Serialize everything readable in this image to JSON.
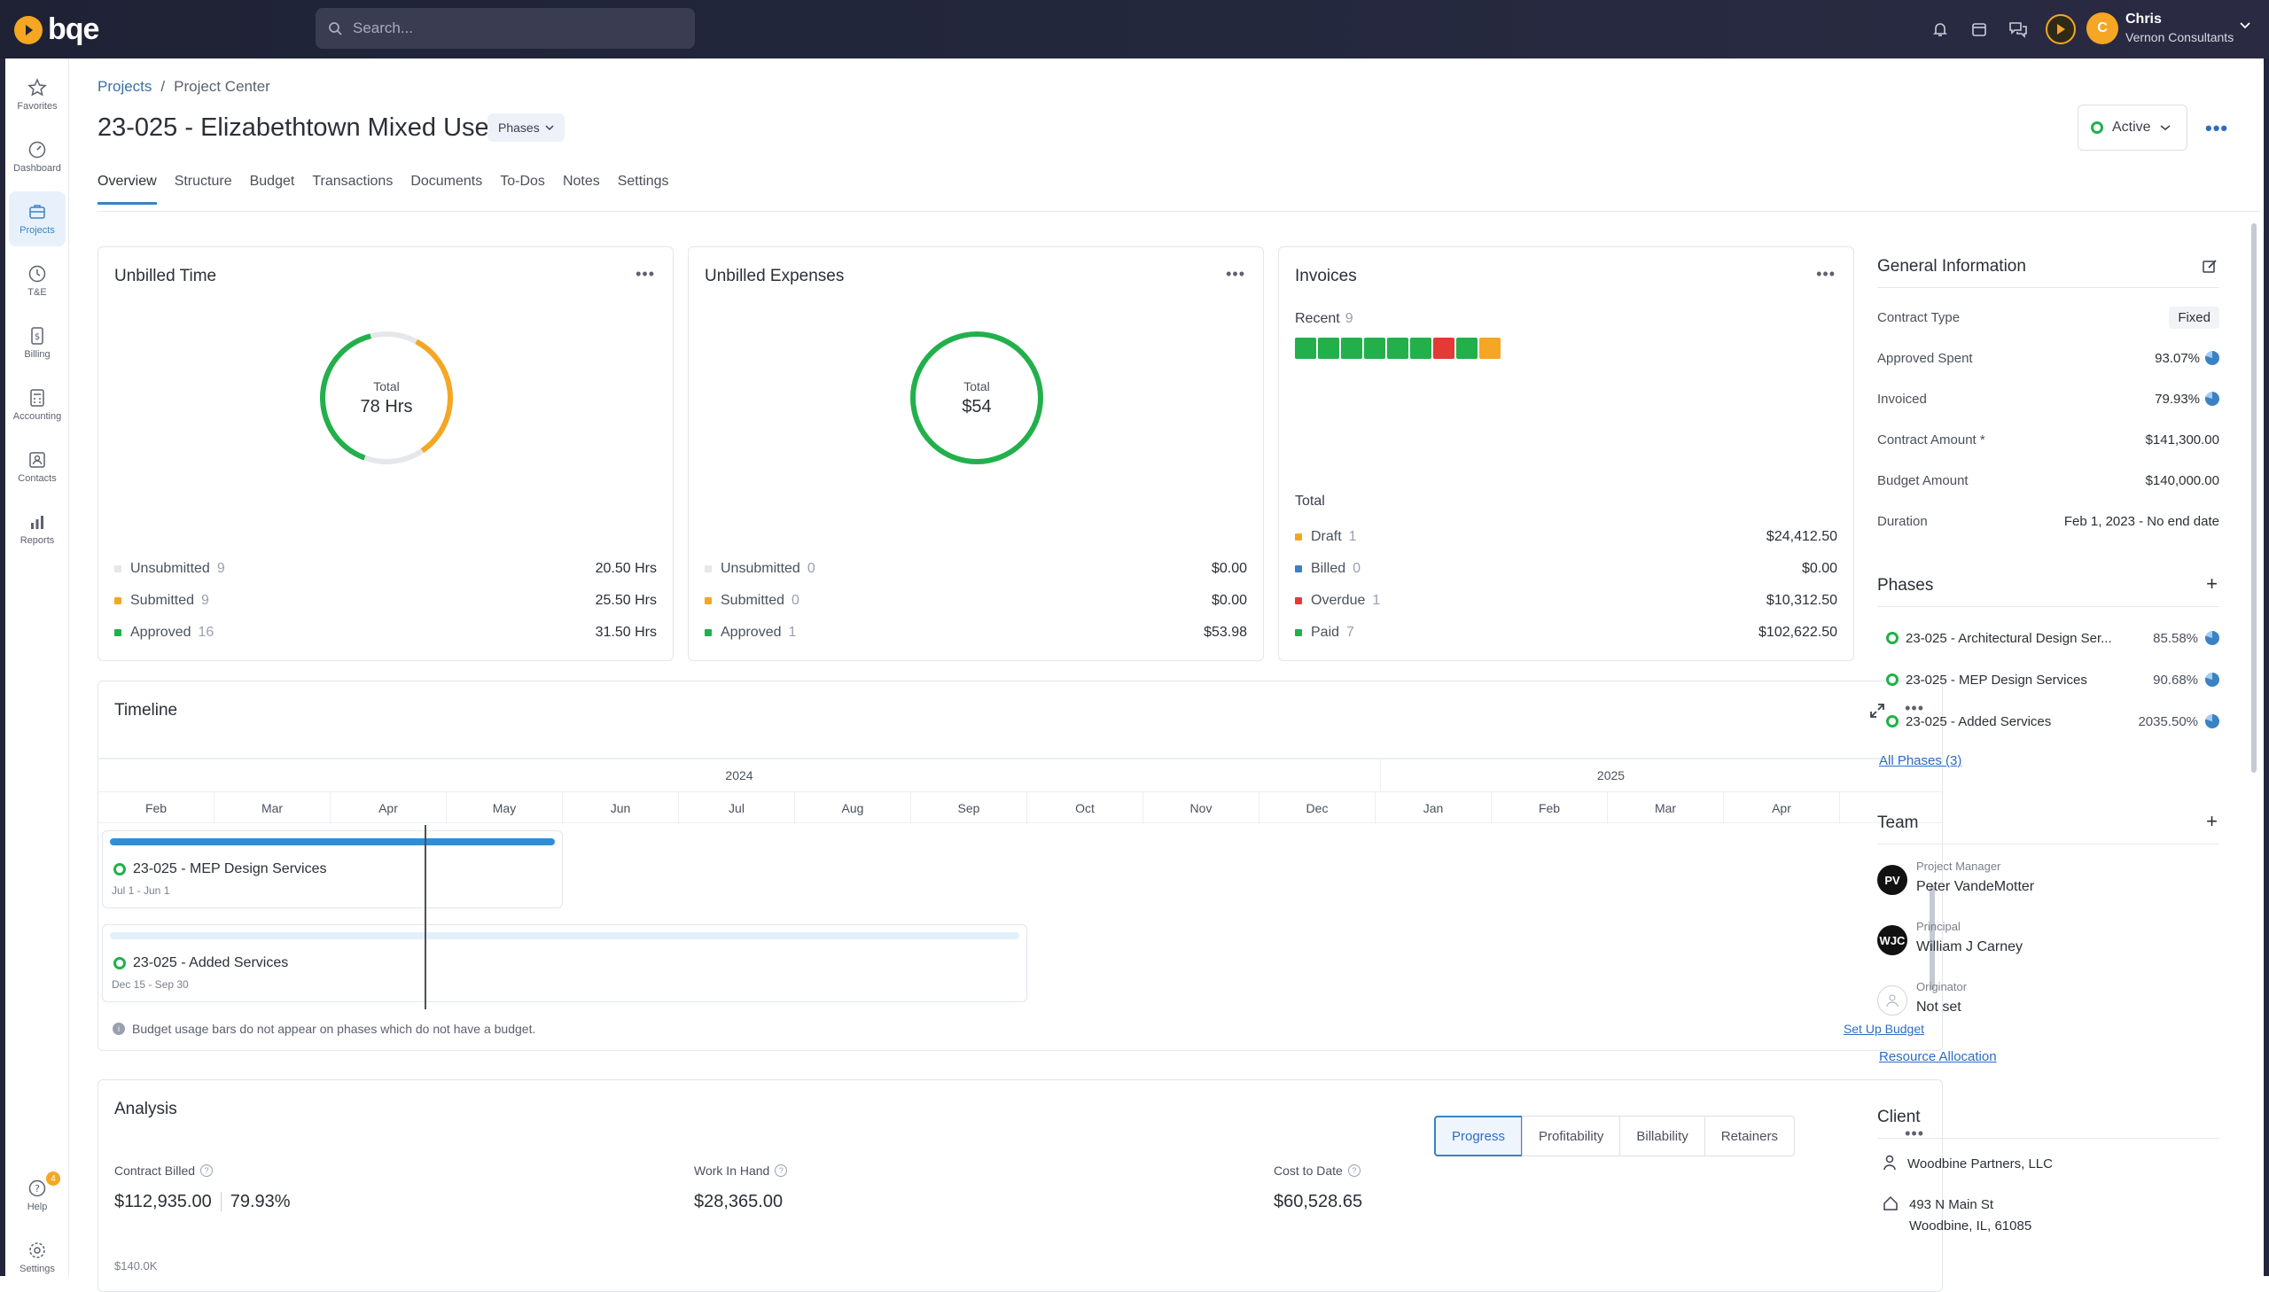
{
  "app": {
    "logo_text": "bqe"
  },
  "search": {
    "placeholder": "Search..."
  },
  "user": {
    "initial": "C",
    "name": "Chris",
    "org": "Vernon Consultants"
  },
  "sidebar": {
    "items": [
      {
        "label": "Favorites",
        "icon": "star-icon"
      },
      {
        "label": "Dashboard",
        "icon": "gauge-icon"
      },
      {
        "label": "Projects",
        "icon": "projects-icon"
      },
      {
        "label": "T&E",
        "icon": "clock-icon"
      },
      {
        "label": "Billing",
        "icon": "billing-icon"
      },
      {
        "label": "Accounting",
        "icon": "calculator-icon"
      },
      {
        "label": "Contacts",
        "icon": "contacts-icon"
      },
      {
        "label": "Reports",
        "icon": "reports-icon"
      }
    ],
    "help_label": "Help",
    "help_badge": "4",
    "settings_label": "Settings"
  },
  "breadcrumb": {
    "root": "Projects",
    "sep": "/",
    "current": "Project Center"
  },
  "project": {
    "title": "23-025 - Elizabethtown Mixed Use",
    "phases_label": "Phases",
    "status": "Active"
  },
  "tabs": [
    "Overview",
    "Structure",
    "Budget",
    "Transactions",
    "Documents",
    "To-Dos",
    "Notes",
    "Settings"
  ],
  "unbilled_time": {
    "title": "Unbilled Time",
    "total_label": "Total",
    "total_value": "78 Hrs",
    "rows": [
      {
        "label": "Unsubmitted",
        "count": "9",
        "value": "20.50 Hrs",
        "color": "#e5e7eb"
      },
      {
        "label": "Submitted",
        "count": "9",
        "value": "25.50 Hrs",
        "color": "#f5a623"
      },
      {
        "label": "Approved",
        "count": "16",
        "value": "31.50 Hrs",
        "color": "#22b04b"
      }
    ]
  },
  "unbilled_expenses": {
    "title": "Unbilled Expenses",
    "total_label": "Total",
    "total_value": "$54",
    "rows": [
      {
        "label": "Unsubmitted",
        "count": "0",
        "value": "$0.00",
        "color": "#e5e7eb"
      },
      {
        "label": "Submitted",
        "count": "0",
        "value": "$0.00",
        "color": "#f5a623"
      },
      {
        "label": "Approved",
        "count": "1",
        "value": "$53.98",
        "color": "#22b04b"
      }
    ]
  },
  "invoices": {
    "title": "Invoices",
    "recent_label": "Recent",
    "recent_count": "9",
    "recent_colors": [
      "#22b04b",
      "#22b04b",
      "#22b04b",
      "#22b04b",
      "#22b04b",
      "#22b04b",
      "#e53935",
      "#22b04b",
      "#f5a623"
    ],
    "total_label": "Total",
    "rows": [
      {
        "label": "Draft",
        "count": "1",
        "value": "$24,412.50",
        "color": "#f5a623"
      },
      {
        "label": "Billed",
        "count": "0",
        "value": "$0.00",
        "color": "#3b82c4"
      },
      {
        "label": "Overdue",
        "count": "1",
        "value": "$10,312.50",
        "color": "#e53935"
      },
      {
        "label": "Paid",
        "count": "7",
        "value": "$102,622.50",
        "color": "#22b04b"
      }
    ]
  },
  "timeline": {
    "title": "Timeline",
    "years": [
      "2024",
      "2025"
    ],
    "months": [
      "Feb",
      "Mar",
      "Apr",
      "May",
      "Jun",
      "Jul",
      "Aug",
      "Sep",
      "Oct",
      "Nov",
      "Dec",
      "Jan",
      "Feb",
      "Mar",
      "Apr"
    ],
    "phases": [
      {
        "name": "23-025 - MEP Design Services",
        "dates": "Jul 1 - Jun 1"
      },
      {
        "name": "23-025 - Added Services",
        "dates": "Dec 15 - Sep 30"
      }
    ],
    "note": "Budget usage bars do not appear on phases which do not have a budget.",
    "setup_link": "Set Up Budget"
  },
  "analysis": {
    "title": "Analysis",
    "tabs": [
      "Progress",
      "Profitability",
      "Billability",
      "Retainers"
    ],
    "metrics": [
      {
        "label": "Contract Billed",
        "value": "$112,935.00",
        "extra": "79.93%"
      },
      {
        "label": "Work In Hand",
        "value": "$28,365.00"
      },
      {
        "label": "Cost to Date",
        "value": "$60,528.65"
      }
    ],
    "axis_first": "$140.0K"
  },
  "general_info": {
    "title": "General Information",
    "rows": [
      {
        "label": "Contract Type",
        "value": "Fixed"
      },
      {
        "label": "Approved Spent",
        "value": "93.07%"
      },
      {
        "label": "Invoiced",
        "value": "79.93%"
      },
      {
        "label": "Contract Amount *",
        "value": "$141,300.00"
      },
      {
        "label": "Budget Amount",
        "value": "$140,000.00"
      },
      {
        "label": "Duration",
        "value": "Feb 1, 2023 - No end date"
      }
    ]
  },
  "phases_panel": {
    "title": "Phases",
    "items": [
      {
        "name": "23-025 - Architectural Design Ser...",
        "pct": "85.58%"
      },
      {
        "name": "23-025 - MEP Design Services",
        "pct": "90.68%"
      },
      {
        "name": "23-025 - Added Services",
        "pct": "2035.50%"
      }
    ],
    "all_link": "All Phases (3)"
  },
  "team": {
    "title": "Team",
    "members": [
      {
        "role": "Project Manager",
        "name": "Peter VandeMotter",
        "initials": "PV"
      },
      {
        "role": "Principal",
        "name": "William J Carney",
        "initials": "WJC"
      },
      {
        "role": "Originator",
        "name": "Not set",
        "initials": ""
      }
    ],
    "resource_link": "Resource Allocation"
  },
  "client": {
    "title": "Client",
    "name": "Woodbine Partners, LLC",
    "address1": "493 N Main St",
    "address2": "Woodbine, IL, 61085"
  },
  "colors": {
    "accent": "#3b82c4",
    "green": "#22b04b",
    "orange": "#f5a623",
    "red": "#e53935"
  }
}
